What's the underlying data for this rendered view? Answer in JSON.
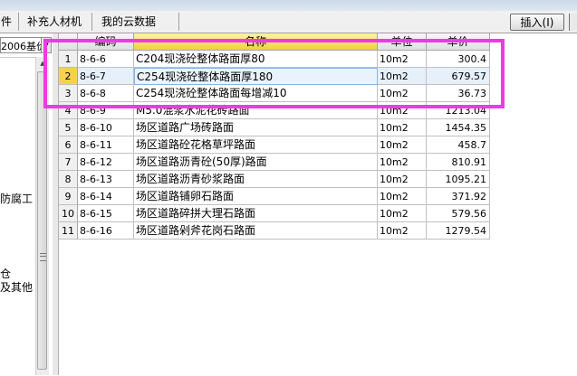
{
  "tabs": [
    {
      "label": "件"
    },
    {
      "label": "补充人材机"
    },
    {
      "label": "我的云数据"
    }
  ],
  "toolbar": {
    "insert_label": "插入(I)"
  },
  "left_panel": {
    "dropdown_value": "2006基价",
    "list_texts": [
      "防腐工",
      "仓",
      "及其他"
    ]
  },
  "grid": {
    "columns": [
      "编码",
      "名称",
      "单位",
      "单价"
    ],
    "rows": [
      {
        "idx": "1",
        "code": "8-6-6",
        "name": "C204现浇砼整体路面厚80",
        "unit": "10m2",
        "price": "300.4"
      },
      {
        "idx": "2",
        "code": "8-6-7",
        "name": "C254现浇砼整体路面厚180",
        "unit": "10m2",
        "price": "679.57"
      },
      {
        "idx": "3",
        "code": "8-6-8",
        "name": "C254现浇砼整体路面每增减10",
        "unit": "10m2",
        "price": "36.73"
      },
      {
        "idx": "4",
        "code": "8-6-9",
        "name": "M5.0混浆水泥花砖路面",
        "unit": "10m2",
        "price": "1213.04"
      },
      {
        "idx": "5",
        "code": "8-6-10",
        "name": "场区道路广场砖路面",
        "unit": "10m2",
        "price": "1454.35"
      },
      {
        "idx": "6",
        "code": "8-6-11",
        "name": "场区道路砼花格草坪路面",
        "unit": "10m2",
        "price": "458.7"
      },
      {
        "idx": "7",
        "code": "8-6-12",
        "name": "场区道路沥青砼(50厚)路面",
        "unit": "10m2",
        "price": "810.91"
      },
      {
        "idx": "8",
        "code": "8-6-13",
        "name": "场区道路沥青砂浆路面",
        "unit": "10m2",
        "price": "1095.21"
      },
      {
        "idx": "9",
        "code": "8-6-14",
        "name": "场区道路铺卵石路面",
        "unit": "10m2",
        "price": "371.92"
      },
      {
        "idx": "10",
        "code": "8-6-15",
        "name": "场区道路碎拼大理石路面",
        "unit": "10m2",
        "price": "579.56"
      },
      {
        "idx": "11",
        "code": "8-6-16",
        "name": "场区道路剁斧花岗石路面",
        "unit": "10m2",
        "price": "1279.54"
      }
    ]
  },
  "colors": {
    "highlight": "#ec3be6",
    "active_row_marker": "#f6d24a",
    "selection": "#e6f0fb"
  }
}
